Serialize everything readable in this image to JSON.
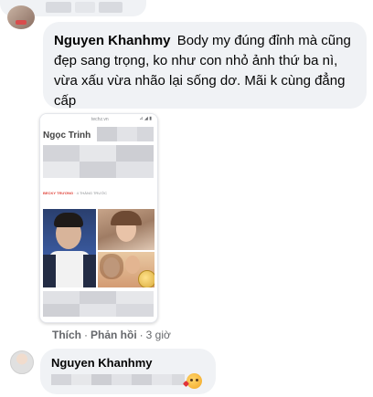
{
  "comment": {
    "author": "Nguyen Khanhmy",
    "text": "Body my đúng đỉnh mà cũng đẹp sang trọng, ko như con nhỏ ảnh thứ ba nì, vừa xấu vừa nhão lại sống dơ. Mãi k cùng đẳng cấp"
  },
  "shared_card": {
    "url": "techz.vn",
    "status_icons": "⊿ ◢ ▮",
    "title": "Ngọc Trinh",
    "byline_author": "BECKY TRƯƠNG",
    "byline_time": "· 4 THÁNG TRƯỚC"
  },
  "actions": {
    "like": "Thích",
    "reply": "Phản hồi",
    "time": "3 giờ"
  },
  "reply": {
    "author": "Nguyen Khanhmy",
    "emoji_icon": "smiling-face-with-hearts-icon"
  }
}
